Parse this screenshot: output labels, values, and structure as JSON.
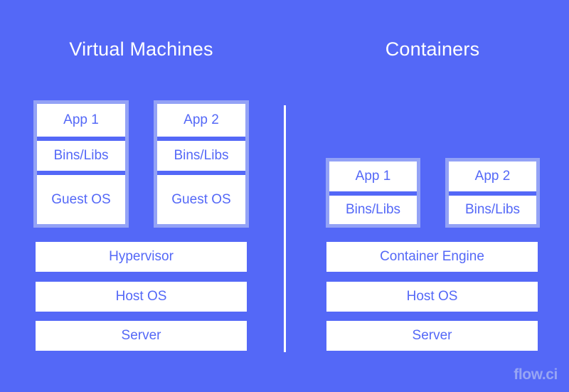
{
  "colors": {
    "background": "#5468f7",
    "box_fill": "#ffffff",
    "box_text": "#5468f7",
    "unit_frame": "#93a2f6",
    "title_text": "#ffffff",
    "brand_text": "#97a5f4",
    "divider": "#ffffff"
  },
  "columns": {
    "left": {
      "title": "Virtual Machines",
      "units": [
        {
          "name": "vm-1",
          "layers": [
            "App 1",
            "Bins/Libs",
            "Guest OS"
          ]
        },
        {
          "name": "vm-2",
          "layers": [
            "App 2",
            "Bins/Libs",
            "Guest OS"
          ]
        }
      ],
      "base_layers": [
        "Hypervisor",
        "Host OS",
        "Server"
      ]
    },
    "right": {
      "title": "Containers",
      "units": [
        {
          "name": "container-1",
          "layers": [
            "App 1",
            "Bins/Libs"
          ]
        },
        {
          "name": "container-2",
          "layers": [
            "App 2",
            "Bins/Libs"
          ]
        }
      ],
      "base_layers": [
        "Container Engine",
        "Host OS",
        "Server"
      ]
    }
  },
  "brand": {
    "label": "flow.ci"
  }
}
